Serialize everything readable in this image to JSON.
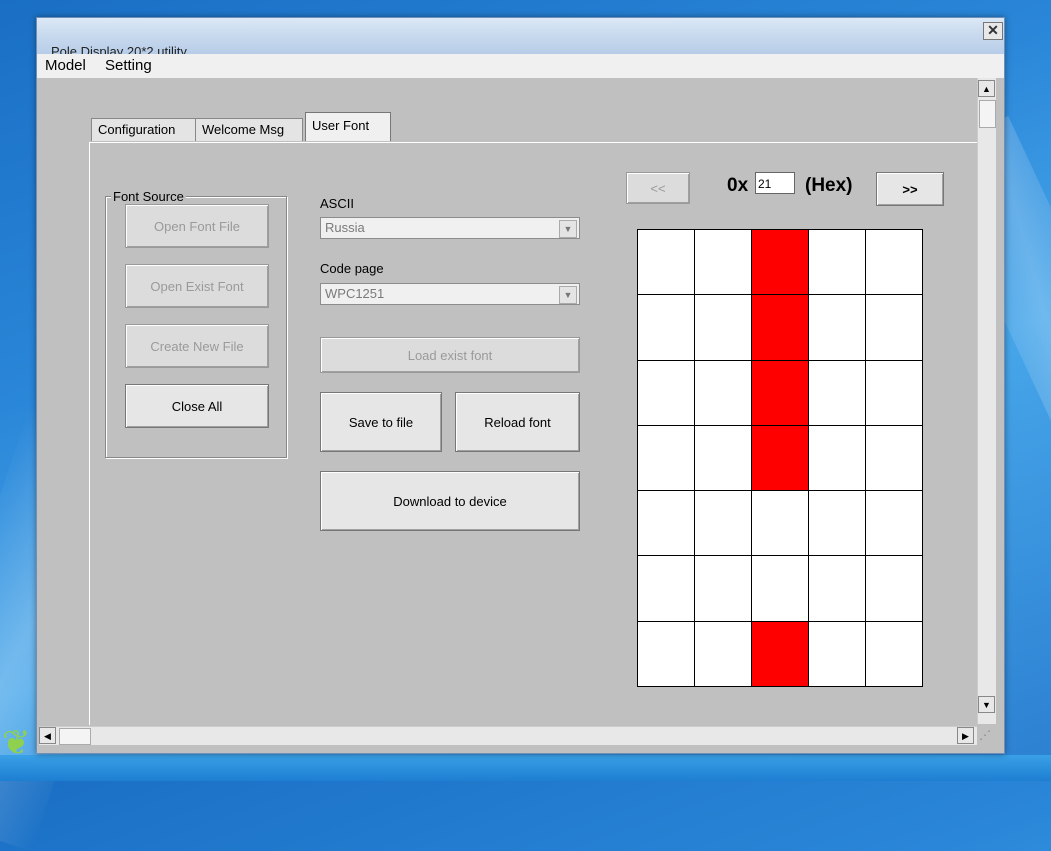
{
  "window": {
    "title": "Pole Display 20*2 utility",
    "close_glyph": "✕"
  },
  "menu": [
    "Model",
    "Setting"
  ],
  "tabs": [
    {
      "label": "Configuration",
      "active": false
    },
    {
      "label": "Welcome Msg",
      "active": false
    },
    {
      "label": "User Font",
      "active": true
    }
  ],
  "font_source": {
    "title": "Font Source",
    "buttons": [
      {
        "label": "Open Font File",
        "enabled": false
      },
      {
        "label": "Open Exist Font",
        "enabled": false
      },
      {
        "label": "Create New File",
        "enabled": false
      },
      {
        "label": "Close All",
        "enabled": true
      }
    ]
  },
  "ascii": {
    "label": "ASCII",
    "value": "Russia"
  },
  "code_page": {
    "label": "Code page",
    "value": "WPC1251"
  },
  "actions": {
    "load_exist_font": "Load exist font",
    "save_to_file": "Save to file",
    "reload_font": "Reload font",
    "download": "Download to device"
  },
  "char_nav": {
    "prev": "<<",
    "prefix": "0x",
    "code": "21",
    "suffix": "(Hex)",
    "next": ">>"
  },
  "glyph": {
    "cols": 5,
    "rows": 7,
    "on_color": "#ff0000",
    "off_color": "#ffffff",
    "pixels": [
      [
        0,
        0,
        1,
        0,
        0
      ],
      [
        0,
        0,
        1,
        0,
        0
      ],
      [
        0,
        0,
        1,
        0,
        0
      ],
      [
        0,
        0,
        1,
        0,
        0
      ],
      [
        0,
        0,
        0,
        0,
        0
      ],
      [
        0,
        0,
        0,
        0,
        0
      ],
      [
        0,
        0,
        1,
        0,
        0
      ]
    ]
  },
  "icons": {
    "scroll_up": "▲",
    "scroll_down": "▼",
    "scroll_left": "◀",
    "scroll_right": "▶",
    "combo_arrow": "▼"
  }
}
